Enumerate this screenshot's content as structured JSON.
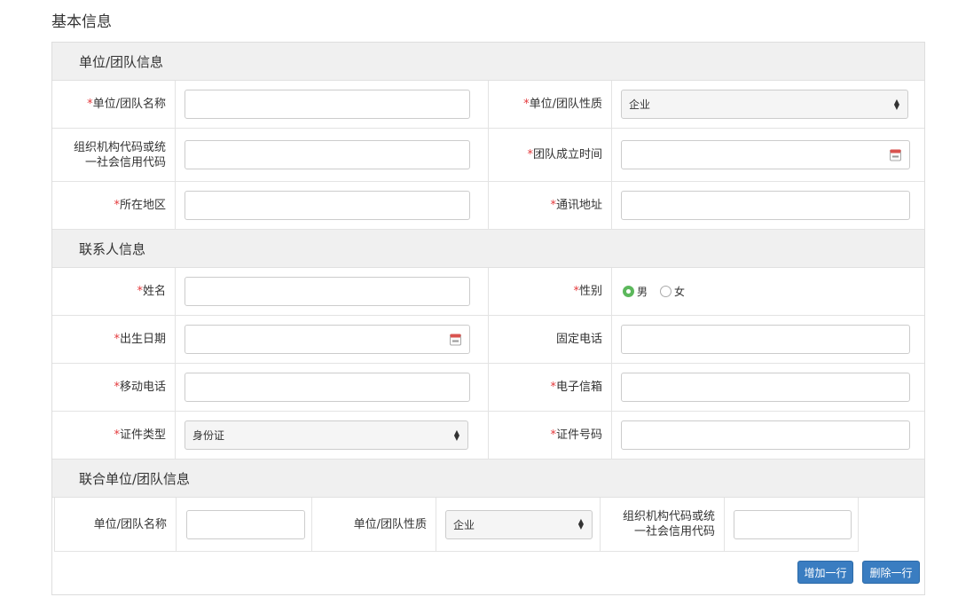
{
  "page_title": "基本信息",
  "required_mark": "*",
  "colors": {
    "required": "#e4393c",
    "button": "#3a7dc1",
    "radio_on": "#5cb85c",
    "section_bg": "#f0f0f0"
  },
  "sections": {
    "unit": {
      "title": "单位/团队信息"
    },
    "contact": {
      "title": "联系人信息"
    },
    "joint": {
      "title": "联合单位/团队信息"
    }
  },
  "unit": {
    "name_label": "单位/团队名称",
    "name_value": "",
    "type_label": "单位/团队性质",
    "type_value": "企业",
    "code_label_line1": "组织机构代码或统",
    "code_label_line2": "一社会信用代码",
    "code_value": "",
    "founded_label": "团队成立时间",
    "founded_value": "",
    "region_label": "所在地区",
    "region_value": "",
    "address_label": "通讯地址",
    "address_value": ""
  },
  "contact": {
    "name_label": "姓名",
    "name_value": "",
    "gender_label": "性别",
    "gender_options": [
      "男",
      "女"
    ],
    "gender_selected": "男",
    "birth_label": "出生日期",
    "birth_value": "",
    "phone_label": "固定电话",
    "phone_value": "",
    "mobile_label": "移动电话",
    "mobile_value": "",
    "email_label": "电子信箱",
    "email_value": "",
    "id_type_label": "证件类型",
    "id_type_value": "身份证",
    "id_no_label": "证件号码",
    "id_no_value": ""
  },
  "joint": {
    "name_label": "单位/团队名称",
    "name_value": "",
    "type_label": "单位/团队性质",
    "type_value": "企业",
    "code_label_line1": "组织机构代码或统",
    "code_label_line2": "一社会信用代码",
    "code_value": ""
  },
  "buttons": {
    "add_row": "增加一行",
    "delete_row": "删除一行"
  },
  "icons": {
    "calendar": "calendar-icon",
    "select_arrows": "sort-arrows-icon"
  }
}
